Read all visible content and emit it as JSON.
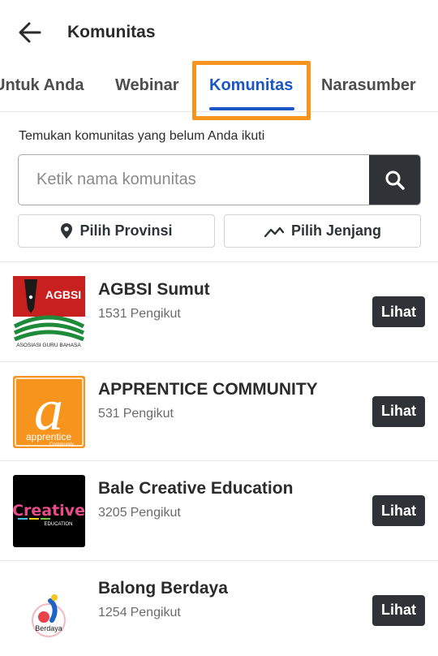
{
  "appbar": {
    "title": "Komunitas",
    "back_icon": "arrow-left-icon"
  },
  "tabs": [
    {
      "label": "Untuk Anda",
      "active": false
    },
    {
      "label": "Webinar",
      "active": false
    },
    {
      "label": "Komunitas",
      "active": true
    },
    {
      "label": "Narasumber",
      "active": false
    }
  ],
  "colors": {
    "accent": "#1a56c4",
    "highlight": "#f7941d",
    "dark_button": "#2f3337"
  },
  "search": {
    "hint": "Temukan komunitas yang belum Anda ikuti",
    "placeholder": "Ketik nama komunitas",
    "value": "",
    "icon": "search-icon"
  },
  "filters": {
    "province": {
      "label": "Pilih Provinsi",
      "icon": "map-pin-icon"
    },
    "level": {
      "label": "Pilih Jenjang",
      "icon": "trend-line-icon"
    }
  },
  "communities": [
    {
      "name": "AGBSI Sumut",
      "followers": "1531",
      "followers_label": "Pengikut",
      "action": "Lihat",
      "logo_text": "AGBSI",
      "logo_caption": "ASOSIASI GURU BAHASA"
    },
    {
      "name": "APPRENTICE COMMUNITY",
      "followers": "531",
      "followers_label": "Pengikut",
      "action": "Lihat",
      "logo_text": "apprentice",
      "logo_caption": "Community"
    },
    {
      "name": "Bale Creative Education",
      "followers": "3205",
      "followers_label": "Pengikut",
      "action": "Lihat",
      "logo_text": "Creative",
      "logo_caption": "EDUCATION"
    },
    {
      "name": "Balong Berdaya",
      "followers": "1254",
      "followers_label": "Pengikut",
      "action": "Lihat",
      "logo_text": "Berdaya",
      "logo_caption": ""
    }
  ]
}
